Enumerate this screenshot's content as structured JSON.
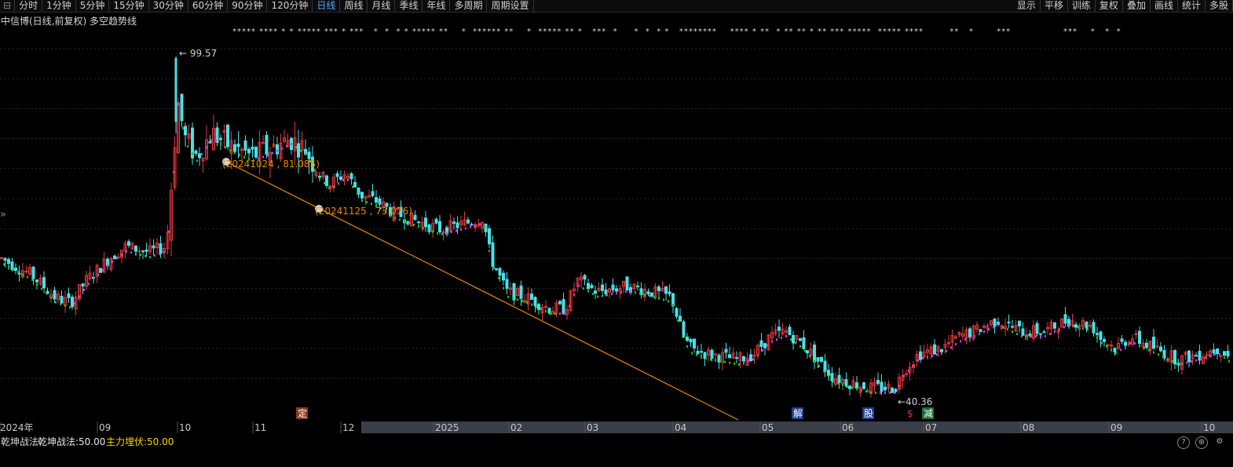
{
  "toolbar": {
    "left_tabs": [
      "分时",
      "1分钟",
      "5分钟",
      "15分钟",
      "30分钟",
      "60分钟",
      "90分钟",
      "120分钟",
      "日线",
      "周线",
      "月线",
      "季线",
      "年线",
      "多周期",
      "周期设置"
    ],
    "active_tab": "日线",
    "right_tabs": [
      "显示",
      "平移",
      "训练",
      "复权",
      "叠加",
      "画线",
      "统计",
      "多股"
    ]
  },
  "title": "中信博(日线,前复权) 多空趋势线",
  "chart_data": {
    "type": "candlestick",
    "y_range": [
      36,
      104
    ],
    "max_label": "99.57",
    "min_label": "40.36",
    "annotations": [
      "(20241024 , 81.085)",
      "(20241125 , 73.076)"
    ],
    "trendline": {
      "from": [
        "20241024",
        81.085
      ],
      "to": [
        "20241125",
        73.076
      ]
    },
    "x_ticks": [
      "2024年",
      "09",
      "10",
      "11",
      "12",
      "2025",
      "02",
      "03",
      "04",
      "05",
      "06",
      "07",
      "08",
      "09",
      "10"
    ],
    "event_markers": [
      "定",
      "解",
      "股",
      "$",
      "减"
    ],
    "star_row": "***** **** * * ***** *** * ***   *  *  * * ***** **    *  ****** **    *  ***** ** *   ***  *     *  *  * *   ********    **** * **  * ** ** * ** *** *****  ***** ****        **   *       ***                ***    *   *  *"
  },
  "indicator": {
    "name": "乾坤战法",
    "value1": "乾坤战法:50.00",
    "value2": "主力埋伏:50.00"
  },
  "icons": [
    "help-icon",
    "zoom-icon",
    "settings-icon"
  ],
  "colors": {
    "up": "#e0393e",
    "down": "#48e0e8",
    "trend_green": "#19c21c",
    "trend_magenta": "#d43ad6",
    "trendline": "#e68a00",
    "highlight": "#4fa8ff"
  }
}
